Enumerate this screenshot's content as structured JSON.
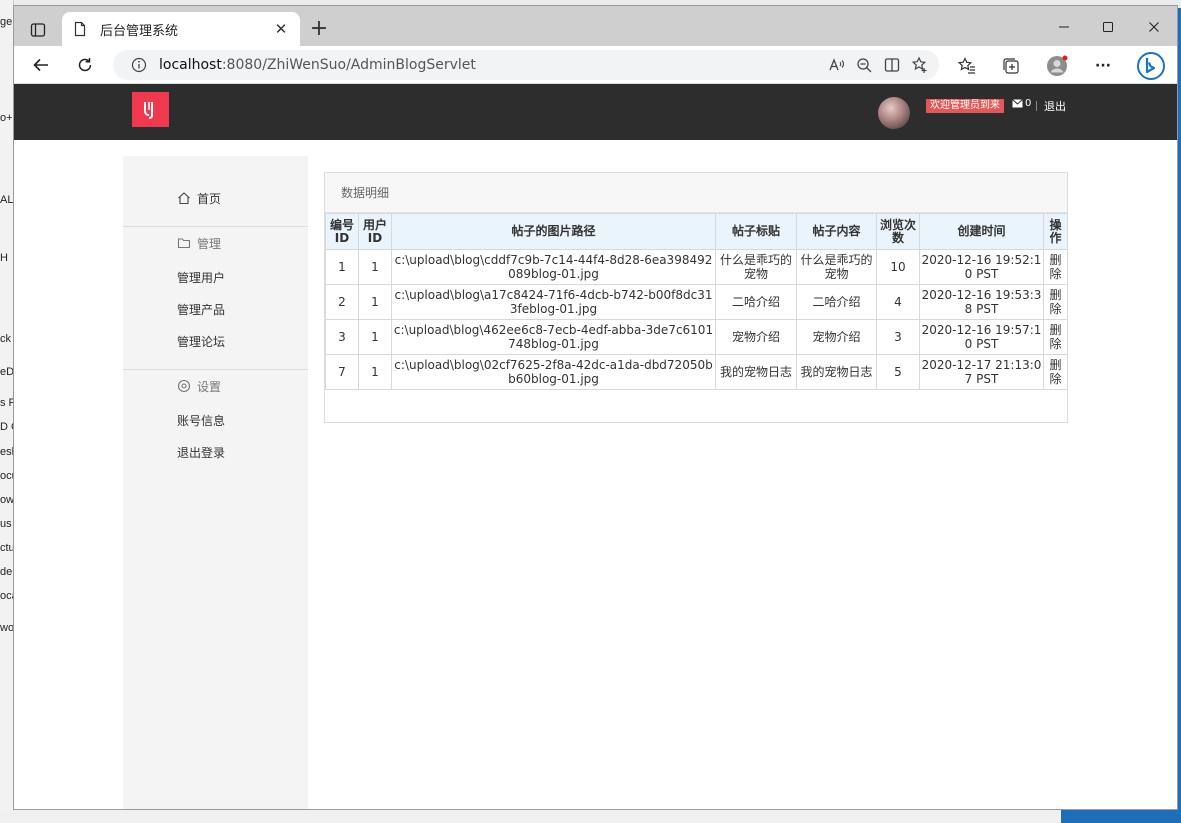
{
  "browser": {
    "tab_title": "后台管理系统",
    "url_host": "localhost",
    "url_rest": ":8080/ZhiWenSuo/AdminBlogServlet",
    "new_tab": "+",
    "tab_close": "✕",
    "minimize": "—",
    "maximize": "☐",
    "close": "✕",
    "more": "···"
  },
  "header": {
    "logo_glyph": "Y",
    "welcome": "欢迎管理员到来",
    "message_count": "0",
    "logout": "退出"
  },
  "sidebar": {
    "home": "首页",
    "manage_group": "管理",
    "manage_items": [
      "管理用户",
      "管理产品",
      "管理论坛"
    ],
    "settings_group": "设置",
    "settings_items": [
      "账号信息",
      "退出登录"
    ]
  },
  "panel": {
    "title": "数据明细",
    "columns": [
      "编号ID",
      "用户ID",
      "帖子的图片路径",
      "帖子标贴",
      "帖子内容",
      "浏览次数",
      "创建时间",
      "操作"
    ],
    "rows": [
      {
        "id": "1",
        "user_id": "1",
        "image_path": "c:\\upload\\blog\\cddf7c9b-7c14-44f4-8d28-6ea398492089blog-01.jpg",
        "title": "什么是乖巧的宠物",
        "content": "什么是乖巧的宠物",
        "views": "10",
        "created": "2020-12-16 19:52:10 PST",
        "action": "删除"
      },
      {
        "id": "2",
        "user_id": "1",
        "image_path": "c:\\upload\\blog\\a17c8424-71f6-4dcb-b742-b00f8dc313feblog-01.jpg",
        "title": "二哈介绍",
        "content": "二哈介绍",
        "views": "4",
        "created": "2020-12-16 19:53:38 PST",
        "action": "删除"
      },
      {
        "id": "3",
        "user_id": "1",
        "image_path": "c:\\upload\\blog\\462ee6c8-7ecb-4edf-abba-3de7c6101748blog-01.jpg",
        "title": "宠物介绍",
        "content": "宠物介绍",
        "views": "3",
        "created": "2020-12-16 19:57:10 PST",
        "action": "删除"
      },
      {
        "id": "7",
        "user_id": "1",
        "image_path": "c:\\upload\\blog\\02cf7625-2f8a-42dc-a1da-dbd72050bb60blog-01.jpg",
        "title": "我的宠物日志",
        "content": "我的宠物日志",
        "views": "5",
        "created": "2020-12-17 21:13:07 PST",
        "action": "删除"
      }
    ]
  },
  "desktop_fragments": [
    "ge",
    "o+",
    "ALL",
    "H",
    "ck",
    "eD",
    "s P",
    "D O",
    "esk",
    "ocu",
    "ow",
    "us",
    "ctu",
    "de",
    "oca",
    "wo"
  ]
}
